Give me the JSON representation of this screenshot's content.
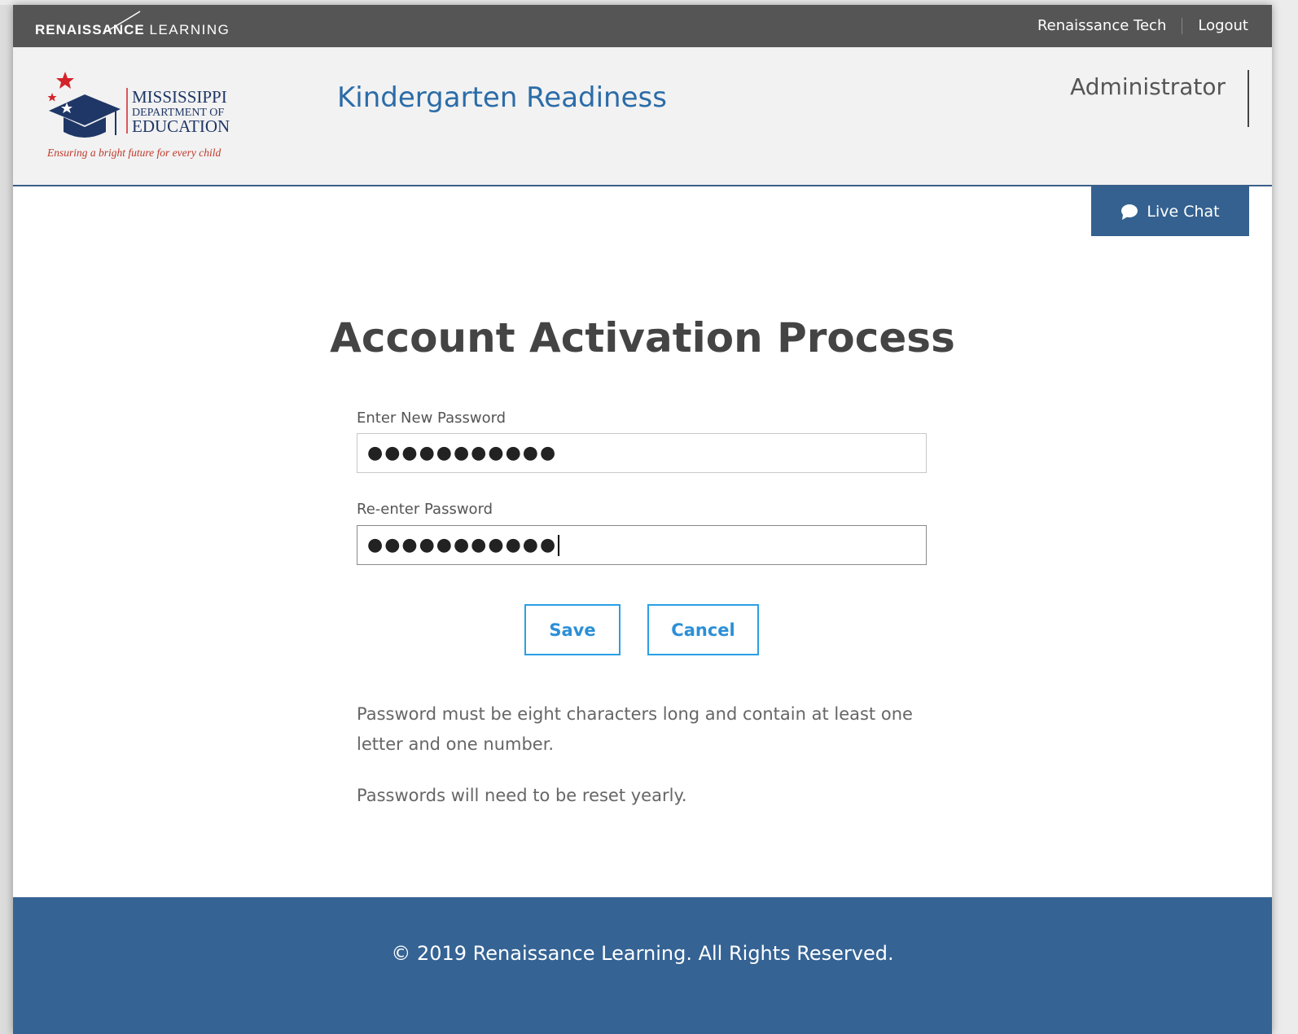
{
  "topbar": {
    "brand_bold": "RENAISSANCE",
    "brand_light": "LEARNING",
    "user_link": "Renaissance Tech",
    "logout_link": "Logout"
  },
  "header": {
    "logo": {
      "line1": "MISSISSIPPI",
      "line2": "DEPARTMENT OF",
      "line3": "EDUCATION",
      "tagline": "Ensuring a bright future for every child"
    },
    "app_title": "Kindergarten Readiness",
    "role": "Administrator"
  },
  "live_chat": {
    "label": "Live Chat"
  },
  "form": {
    "title": "Account Activation Process",
    "new_password_label": "Enter New Password",
    "new_password_value": "●●●●●●●●●●●",
    "reenter_password_label": "Re-enter Password",
    "reenter_password_value": "●●●●●●●●●●●",
    "save_label": "Save",
    "cancel_label": "Cancel",
    "hint1": "Password must be eight characters long and contain at least one letter and one number.",
    "hint2": "Passwords will need to be reset yearly."
  },
  "footer": {
    "copyright": "© 2019 Renaissance Learning. All Rights Reserved."
  },
  "colors": {
    "topbar": "#555555",
    "accent_blue": "#2b6ca8",
    "footer": "#356394",
    "button_border": "#29a0e6",
    "logo_red": "#c0392b",
    "logo_navy": "#1f3766"
  }
}
